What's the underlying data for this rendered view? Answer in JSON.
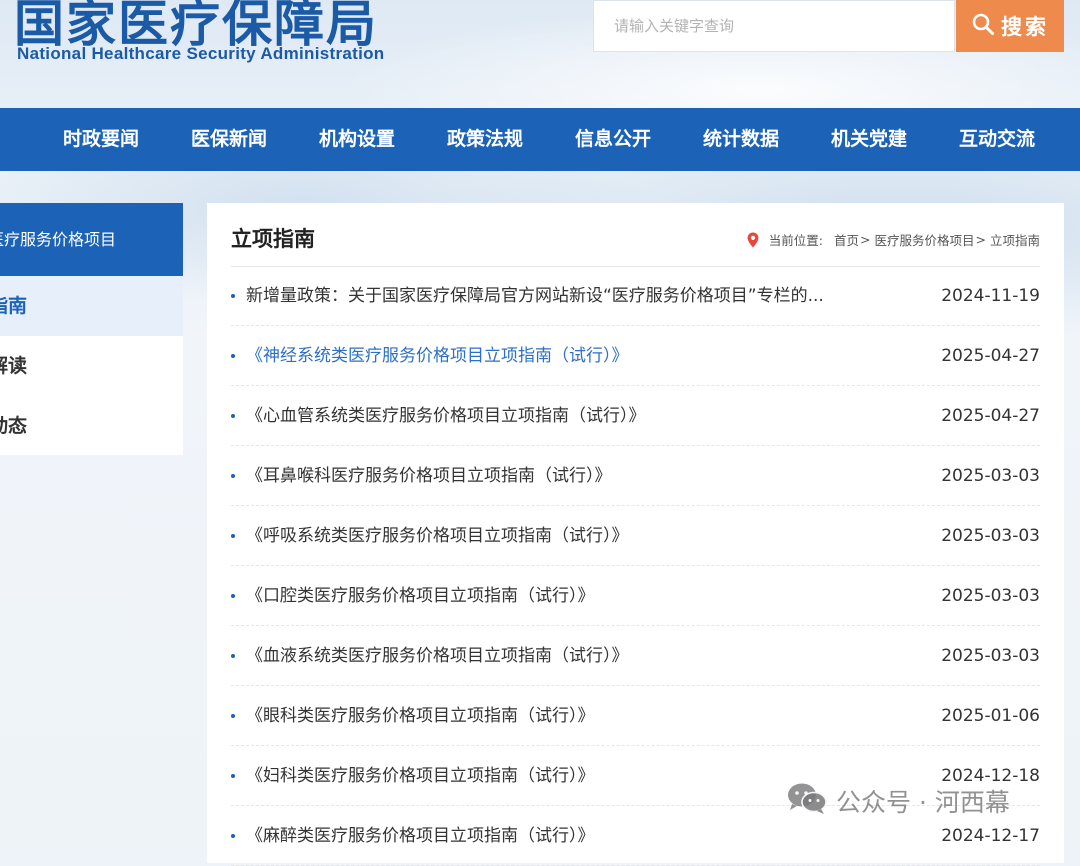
{
  "header": {
    "logo_cn": "国家医疗保障局",
    "logo_en": "National Healthcare Security Administration",
    "search": {
      "placeholder": "请输入关键字查询",
      "button_label": "搜索"
    }
  },
  "nav": {
    "items": [
      {
        "label": "时政要闻"
      },
      {
        "label": "医保新闻"
      },
      {
        "label": "机构设置"
      },
      {
        "label": "政策法规"
      },
      {
        "label": "信息公开"
      },
      {
        "label": "统计数据"
      },
      {
        "label": "机关党建"
      },
      {
        "label": "互动交流"
      }
    ]
  },
  "sidebar": {
    "header": "医疗服务价格项目",
    "items": [
      {
        "label": "立项指南",
        "active": true
      },
      {
        "label": "政策解读",
        "active": false
      },
      {
        "label": "工作动态",
        "active": false
      }
    ]
  },
  "main": {
    "title": "立项指南",
    "breadcrumb": {
      "prefix": "当前位置:",
      "items": [
        "首页",
        "医疗服务价格项目",
        "立项指南"
      ],
      "separator": ">"
    },
    "items": [
      {
        "title": "新增量政策：关于国家医疗保障局官方网站新设“医疗服务价格项目”专栏的...",
        "date": "2024-11-19",
        "highlighted": false
      },
      {
        "title": "《神经系统类医疗服务价格项目立项指南（试行）》",
        "date": "2025-04-27",
        "highlighted": true
      },
      {
        "title": "《心血管系统类医疗服务价格项目立项指南（试行）》",
        "date": "2025-04-27",
        "highlighted": false
      },
      {
        "title": "《耳鼻喉科医疗服务价格项目立项指南（试行）》",
        "date": "2025-03-03",
        "highlighted": false
      },
      {
        "title": "《呼吸系统类医疗服务价格项目立项指南（试行）》",
        "date": "2025-03-03",
        "highlighted": false
      },
      {
        "title": "《口腔类医疗服务价格项目立项指南（试行）》",
        "date": "2025-03-03",
        "highlighted": false
      },
      {
        "title": "《血液系统类医疗服务价格项目立项指南（试行）》",
        "date": "2025-03-03",
        "highlighted": false
      },
      {
        "title": "《眼科类医疗服务价格项目立项指南（试行）》",
        "date": "2025-01-06",
        "highlighted": false
      },
      {
        "title": "《妇科类医疗服务价格项目立项指南（试行）》",
        "date": "2024-12-18",
        "highlighted": false
      },
      {
        "title": "《麻醉类医疗服务价格项目立项指南（试行）》",
        "date": "2024-12-17",
        "highlighted": false
      }
    ]
  },
  "watermark": {
    "text": "公众号 · 河西幕"
  },
  "colors": {
    "brand_blue": "#1c63b7",
    "search_orange": "#ee8a4c",
    "link_highlight": "#2c6fc6",
    "location_pin": "#e8473b"
  },
  "icons": {
    "search_button": "search-icon",
    "breadcrumb": "location-pin-icon",
    "watermark": "wechat-icon"
  }
}
